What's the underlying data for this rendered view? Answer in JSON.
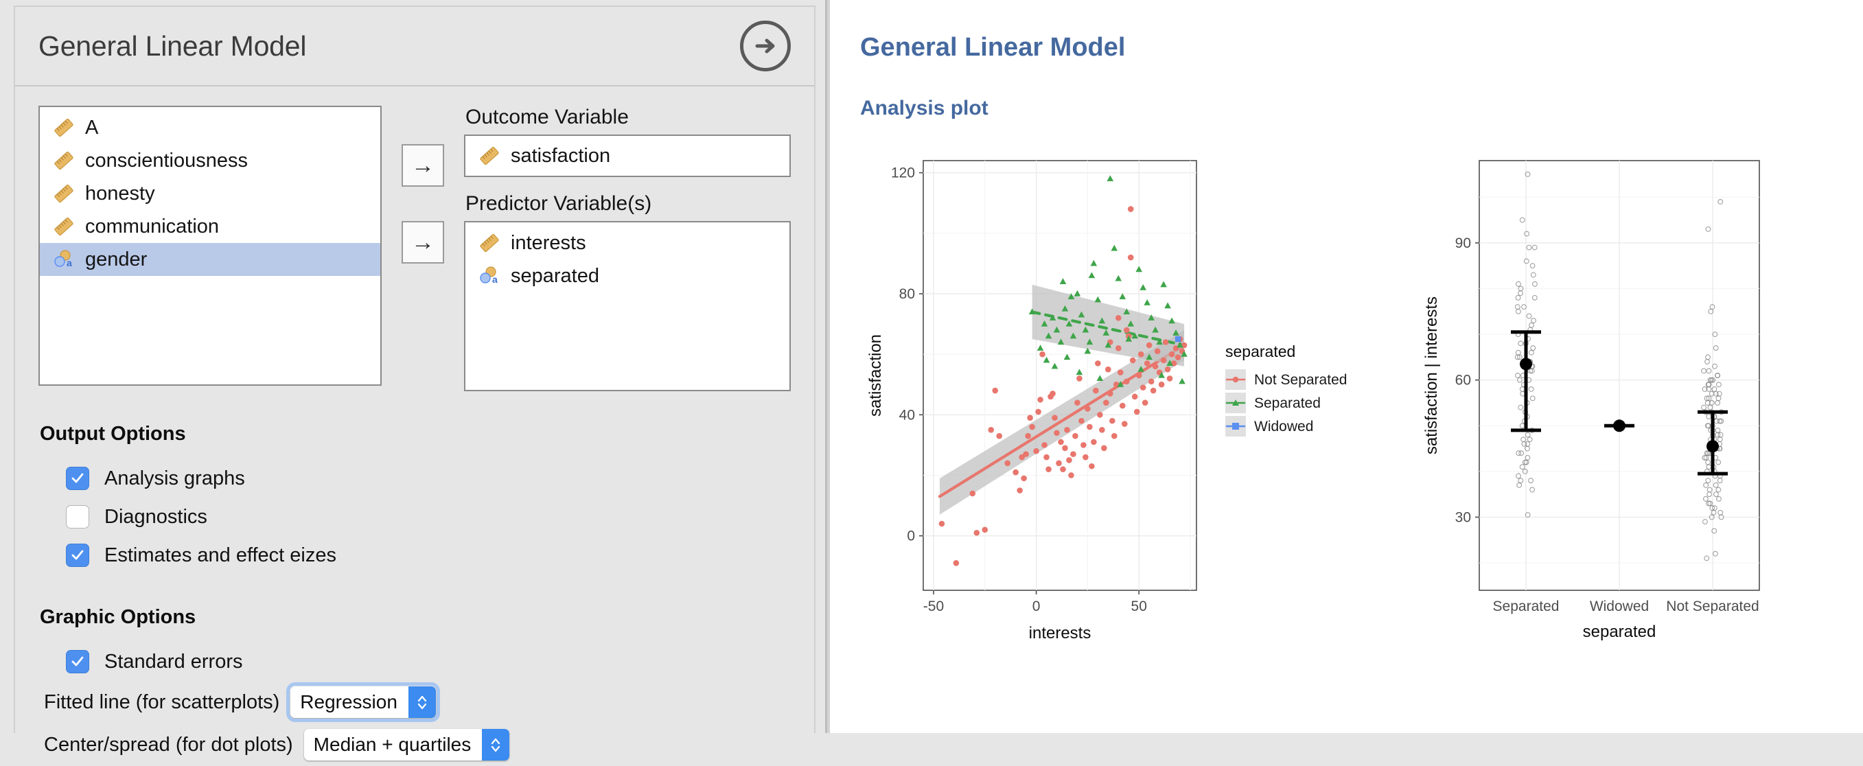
{
  "options_panel": {
    "title": "General Linear Model",
    "run_button_icon": "arrow-right-circle-icon",
    "variable_list": [
      {
        "label": "A",
        "type": "continuous",
        "selected": false
      },
      {
        "label": "conscientiousness",
        "type": "continuous",
        "selected": false
      },
      {
        "label": "honesty",
        "type": "continuous",
        "selected": false
      },
      {
        "label": "communication",
        "type": "continuous",
        "selected": false
      },
      {
        "label": "gender",
        "type": "nominal",
        "selected": true
      }
    ],
    "assign_button_label": "→",
    "outcome": {
      "label": "Outcome Variable",
      "items": [
        {
          "label": "satisfaction",
          "type": "continuous"
        }
      ]
    },
    "predictors": {
      "label": "Predictor Variable(s)",
      "items": [
        {
          "label": "interests",
          "type": "continuous"
        },
        {
          "label": "separated",
          "type": "nominal"
        }
      ]
    },
    "output_options": {
      "title": "Output Options",
      "items": [
        {
          "label": "Analysis graphs",
          "checked": true
        },
        {
          "label": "Diagnostics",
          "checked": false
        },
        {
          "label": "Estimates and effect eizes",
          "checked": true
        }
      ]
    },
    "graphic_options": {
      "title": "Graphic Options",
      "checkboxes": [
        {
          "label": "Standard errors",
          "checked": true
        }
      ],
      "selects": [
        {
          "label": "Fitted line (for scatterplots)",
          "value": "Regression",
          "focused": true
        },
        {
          "label": "Center/spread (for dot plots)",
          "value": "Median + quartiles",
          "focused": false
        }
      ]
    }
  },
  "results_panel": {
    "title": "General Linear Model",
    "subtitle": "Analysis plot"
  },
  "chart_data": [
    {
      "type": "scatter",
      "title": "",
      "xlabel": "interests",
      "ylabel": "satisfaction",
      "xlim": [
        -55,
        78
      ],
      "ylim": [
        -18,
        124
      ],
      "xticks": [
        -50,
        0,
        50
      ],
      "yticks": [
        0,
        40,
        80,
        120
      ],
      "grid": true,
      "legend": {
        "title": "separated",
        "position": "right",
        "entries": [
          {
            "label": "Not Separated",
            "color": "#e8766d",
            "marker": "circle"
          },
          {
            "label": "Separated",
            "color": "#3fa54a",
            "marker": "triangle"
          },
          {
            "label": "Widowed",
            "color": "#5a8ff0",
            "marker": "square"
          }
        ]
      },
      "series": [
        {
          "name": "Not Separated",
          "color": "#e8766d",
          "marker": "circle",
          "fit": {
            "kind": "regression",
            "x": [
              -47,
              72
            ],
            "y": [
              13,
              63
            ],
            "se_band": true
          },
          "points": [
            [
              -46,
              4
            ],
            [
              -39,
              -9
            ],
            [
              -31,
              14
            ],
            [
              -29,
              1
            ],
            [
              -25,
              2
            ],
            [
              -22,
              35
            ],
            [
              -20,
              48
            ],
            [
              -18,
              33
            ],
            [
              -14,
              24
            ],
            [
              -10,
              21
            ],
            [
              -8,
              15
            ],
            [
              -7,
              26
            ],
            [
              -6,
              19
            ],
            [
              -5,
              27
            ],
            [
              -4,
              33
            ],
            [
              -3,
              39
            ],
            [
              -2,
              36
            ],
            [
              0,
              28
            ],
            [
              1,
              41
            ],
            [
              2,
              45
            ],
            [
              3,
              60
            ],
            [
              4,
              30
            ],
            [
              5,
              26
            ],
            [
              6,
              22
            ],
            [
              7,
              46
            ],
            [
              8,
              47
            ],
            [
              9,
              39
            ],
            [
              10,
              34
            ],
            [
              11,
              24
            ],
            [
              12,
              31
            ],
            [
              13,
              22
            ],
            [
              14,
              29
            ],
            [
              15,
              35
            ],
            [
              16,
              25
            ],
            [
              17,
              20
            ],
            [
              18,
              27
            ],
            [
              19,
              33
            ],
            [
              20,
              44
            ],
            [
              21,
              52
            ],
            [
              22,
              38
            ],
            [
              23,
              30
            ],
            [
              24,
              26
            ],
            [
              25,
              42
            ],
            [
              26,
              36
            ],
            [
              27,
              23
            ],
            [
              28,
              31
            ],
            [
              29,
              48
            ],
            [
              30,
              57
            ],
            [
              31,
              40
            ],
            [
              32,
              35
            ],
            [
              33,
              29
            ],
            [
              34,
              44
            ],
            [
              35,
              55
            ],
            [
              36,
              47
            ],
            [
              37,
              38
            ],
            [
              38,
              33
            ],
            [
              39,
              50
            ],
            [
              40,
              62
            ],
            [
              41,
              54
            ],
            [
              42,
              43
            ],
            [
              43,
              37
            ],
            [
              44,
              51
            ],
            [
              45,
              66
            ],
            [
              46,
              92
            ],
            [
              47,
              58
            ],
            [
              48,
              46
            ],
            [
              49,
              41
            ],
            [
              50,
              53
            ],
            [
              51,
              60
            ],
            [
              52,
              49
            ],
            [
              53,
              44
            ],
            [
              54,
              57
            ],
            [
              55,
              63
            ],
            [
              56,
              51
            ],
            [
              57,
              48
            ],
            [
              58,
              56
            ],
            [
              59,
              61
            ],
            [
              60,
              54
            ],
            [
              61,
              50
            ],
            [
              62,
              58
            ],
            [
              63,
              64
            ],
            [
              64,
              55
            ],
            [
              65,
              52
            ],
            [
              66,
              60
            ],
            [
              67,
              57
            ],
            [
              68,
              62
            ],
            [
              69,
              59
            ],
            [
              70,
              65
            ],
            [
              71,
              61
            ],
            [
              72,
              63
            ],
            [
              46,
              108
            ],
            [
              44,
              68
            ],
            [
              40,
              72
            ],
            [
              36,
              64
            ]
          ]
        },
        {
          "name": "Separated",
          "color": "#3fa54a",
          "marker": "triangle",
          "fit": {
            "kind": "regression",
            "x": [
              -2,
              72
            ],
            "y": [
              74,
              63
            ],
            "se_band": true
          },
          "points": [
            [
              -2,
              74
            ],
            [
              2,
              62
            ],
            [
              4,
              70
            ],
            [
              6,
              66
            ],
            [
              8,
              72
            ],
            [
              10,
              68
            ],
            [
              12,
              64
            ],
            [
              14,
              75
            ],
            [
              16,
              70
            ],
            [
              18,
              66
            ],
            [
              20,
              80
            ],
            [
              22,
              73
            ],
            [
              24,
              68
            ],
            [
              26,
              64
            ],
            [
              28,
              90
            ],
            [
              30,
              78
            ],
            [
              32,
              71
            ],
            [
              34,
              67
            ],
            [
              36,
              118
            ],
            [
              38,
              95
            ],
            [
              40,
              85
            ],
            [
              42,
              79
            ],
            [
              44,
              74
            ],
            [
              46,
              70
            ],
            [
              48,
              66
            ],
            [
              50,
              88
            ],
            [
              52,
              82
            ],
            [
              54,
              77
            ],
            [
              56,
              72
            ],
            [
              58,
              68
            ],
            [
              60,
              64
            ],
            [
              62,
              83
            ],
            [
              64,
              76
            ],
            [
              66,
              71
            ],
            [
              68,
              67
            ],
            [
              70,
              63
            ],
            [
              72,
              60
            ],
            [
              5,
              58
            ],
            [
              9,
              56
            ],
            [
              15,
              59
            ],
            [
              25,
              61
            ],
            [
              35,
              63
            ],
            [
              45,
              65
            ],
            [
              55,
              59
            ],
            [
              65,
              57
            ],
            [
              21,
              54
            ],
            [
              31,
              52
            ],
            [
              41,
              50
            ],
            [
              51,
              55
            ],
            [
              61,
              53
            ],
            [
              71,
              51
            ],
            [
              13,
              84
            ],
            [
              17,
              79
            ],
            [
              27,
              86
            ]
          ]
        },
        {
          "name": "Widowed",
          "color": "#5a8ff0",
          "marker": "square",
          "fit": null,
          "points": [
            [
              69,
              65
            ]
          ]
        }
      ]
    },
    {
      "type": "scatter",
      "title": "",
      "xlabel": "separated",
      "ylabel": "satisfaction | interests",
      "categories": [
        "Separated",
        "Widowed",
        "Not Separated"
      ],
      "yticks": [
        30,
        60,
        90
      ],
      "ylim": [
        14,
        108
      ],
      "grid": true,
      "center_spread": "Median + quartiles",
      "summary": [
        {
          "category": "Separated",
          "center": 63.5,
          "lower": 49.0,
          "upper": 70.5
        },
        {
          "category": "Widowed",
          "center": 50.0,
          "lower": 50.0,
          "upper": 50.0
        },
        {
          "category": "Not Separated",
          "center": 45.5,
          "lower": 39.5,
          "upper": 53.0
        }
      ],
      "jitter_points": {
        "Separated": [
          105,
          95,
          92,
          89,
          89,
          86,
          85,
          83,
          81,
          81,
          80,
          79,
          78,
          78,
          76,
          76,
          75,
          74,
          73,
          72,
          71,
          70,
          69,
          68,
          68,
          67,
          66,
          66,
          65,
          65,
          64,
          64,
          63,
          63,
          62,
          62,
          61,
          61,
          60,
          60,
          59,
          58,
          58,
          57,
          56,
          55,
          54,
          53,
          52,
          51,
          50,
          49,
          48,
          47,
          47,
          46,
          46,
          45,
          44,
          44,
          43,
          42,
          42,
          41,
          40,
          39,
          38,
          38,
          37,
          36,
          30.5
        ],
        "Widowed": [
          50
        ],
        "Not Separated": [
          99,
          93,
          76,
          75,
          70,
          67,
          65,
          64,
          63,
          62,
          62,
          61,
          61,
          60,
          60,
          60,
          59,
          59,
          59,
          58,
          58,
          58,
          57,
          57,
          57,
          56,
          56,
          56,
          55,
          55,
          55,
          54,
          54,
          53,
          53,
          53,
          52,
          52,
          52,
          51,
          51,
          51,
          50,
          50,
          50,
          49,
          49,
          49,
          48,
          48,
          48,
          47,
          47,
          47,
          46,
          46,
          46,
          45,
          45,
          45,
          44,
          44,
          44,
          43,
          43,
          43,
          42,
          42,
          41,
          41,
          40,
          40,
          39,
          39,
          38,
          38,
          37,
          37,
          36,
          36,
          35,
          35,
          34,
          34,
          33,
          33,
          32,
          32,
          31,
          31,
          30,
          30,
          29,
          27,
          22,
          21
        ]
      }
    }
  ]
}
